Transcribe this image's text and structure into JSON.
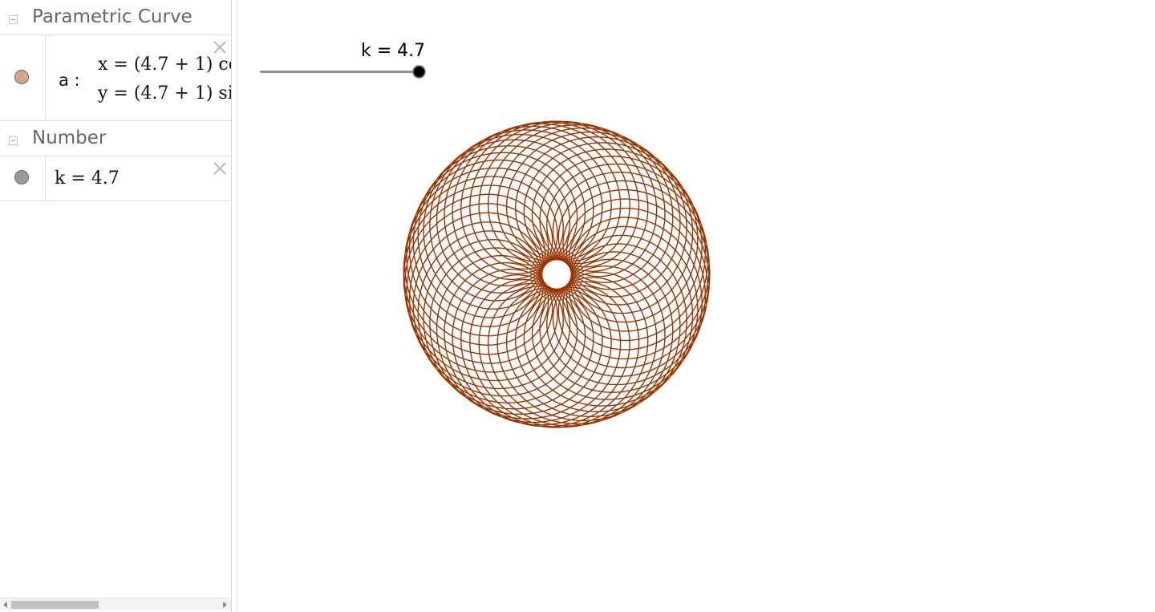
{
  "algebra": {
    "groups": [
      {
        "title": "Parametric Curve",
        "items": [
          {
            "name": "a",
            "label": "a :",
            "marble_color": "#D8A58C",
            "x_expr": "x = (4.7 + 1)  co",
            "y_expr": "y = (4.7 + 1)  si"
          }
        ]
      },
      {
        "title": "Number",
        "items": [
          {
            "name": "k",
            "marble_color": "#999999",
            "expr": "k = 4.7"
          }
        ]
      }
    ]
  },
  "graphics": {
    "slider": {
      "label": "k = 4.7",
      "value": 4.7,
      "min": -5,
      "max": 5
    },
    "curve": {
      "name": "a",
      "color": "#993300",
      "k": 4.7
    }
  },
  "icons": {
    "collapse": "collapse-minus-icon",
    "delete": "close-icon"
  }
}
